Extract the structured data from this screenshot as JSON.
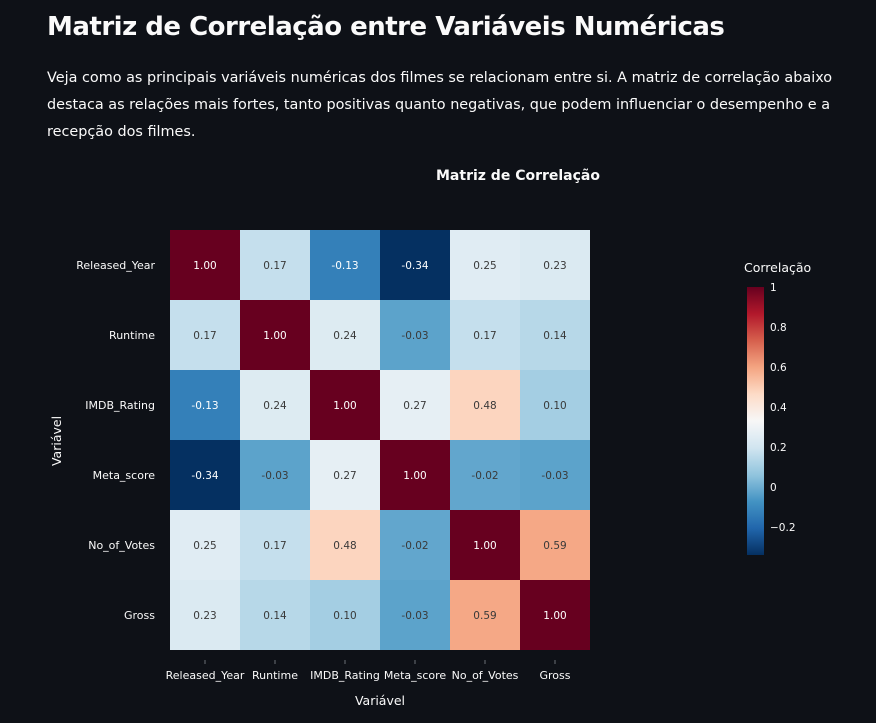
{
  "page": {
    "title": "Matriz de Correlação entre Variáveis Numéricas",
    "intro": "Veja como as principais variáveis numéricas dos filmes se relacionam entre si. A matriz de correlação abaixo destaca as relações mais fortes, tanto positivas quanto negativas, que podem influenciar o desempenho e a recepção dos filmes."
  },
  "chart_data": {
    "type": "heatmap",
    "title": "Matriz de Correlação",
    "xlabel": "Variável",
    "ylabel": "Variável",
    "x": [
      "Released_Year",
      "Runtime",
      "IMDB_Rating",
      "Meta_score",
      "No_of_Votes",
      "Gross"
    ],
    "y": [
      "Released_Year",
      "Runtime",
      "IMDB_Rating",
      "Meta_score",
      "No_of_Votes",
      "Gross"
    ],
    "values": [
      [
        1.0,
        0.17,
        -0.13,
        -0.34,
        0.25,
        0.23
      ],
      [
        0.17,
        1.0,
        0.24,
        -0.03,
        0.17,
        0.14
      ],
      [
        -0.13,
        0.24,
        1.0,
        0.27,
        0.48,
        0.1
      ],
      [
        -0.34,
        -0.03,
        0.27,
        1.0,
        -0.02,
        -0.03
      ],
      [
        0.25,
        0.17,
        0.48,
        -0.02,
        1.0,
        0.59
      ],
      [
        0.23,
        0.14,
        0.1,
        -0.03,
        0.59,
        1.0
      ]
    ],
    "value_format": "0.00",
    "colorscale": "RdBu (reversed)",
    "zrange": [
      -0.34,
      1.0
    ],
    "colorbar": {
      "title": "Correlação",
      "ticks": [
        "1",
        "0.8",
        "0.6",
        "0.4",
        "0.2",
        "0",
        "−0.2"
      ]
    }
  }
}
